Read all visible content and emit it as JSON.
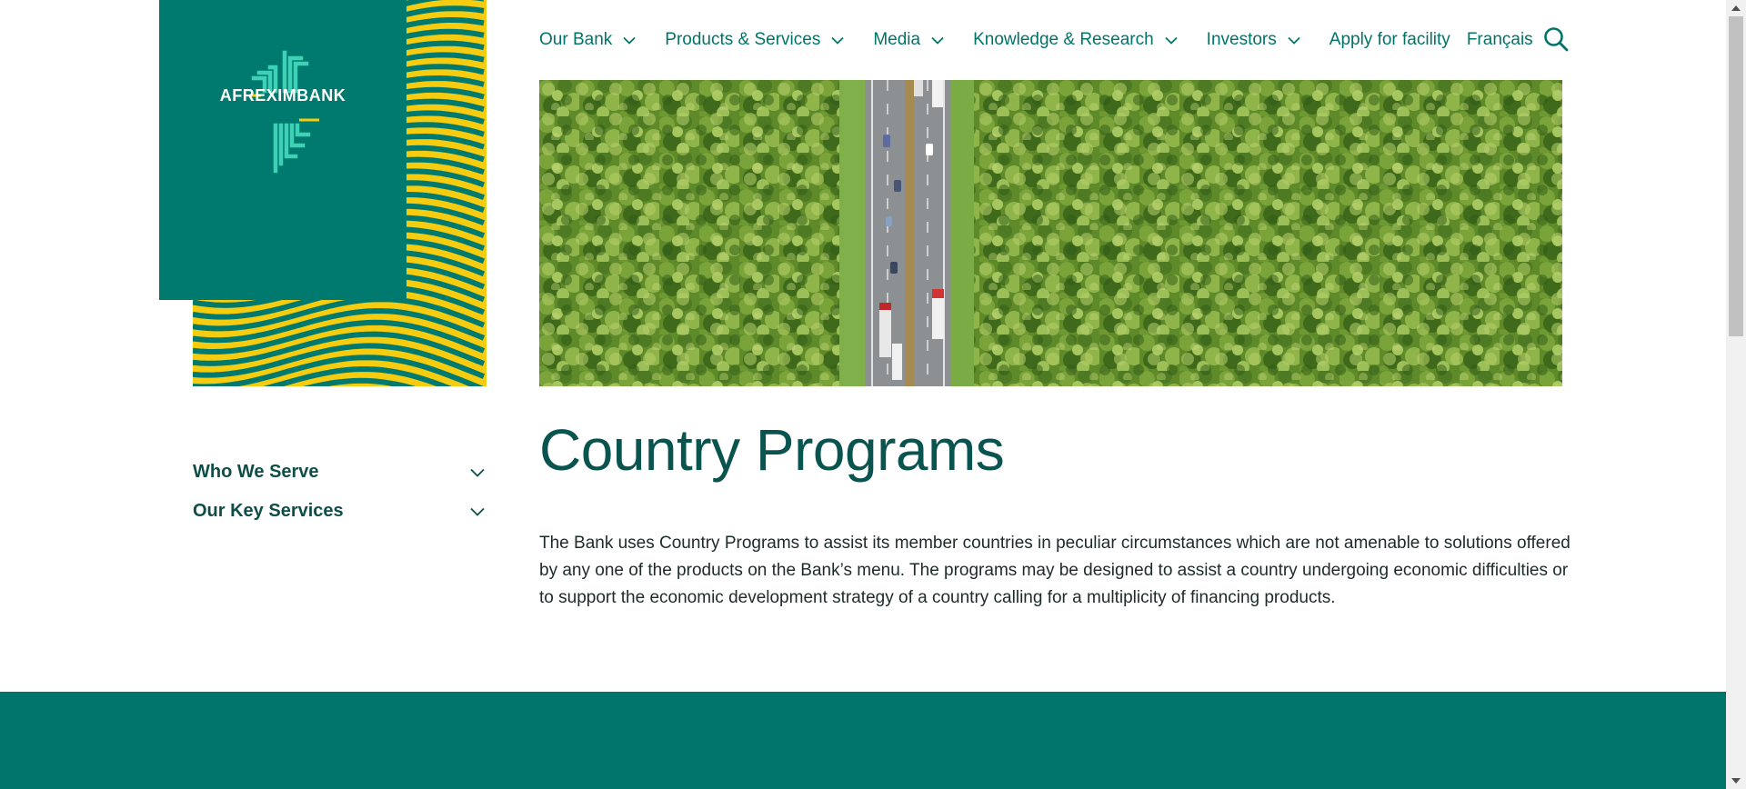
{
  "brand": {
    "name": "AFREXIMBANK",
    "colors": {
      "teal": "#007a6f",
      "yellow": "#f5cc0f",
      "light_teal": "#3fd1b6",
      "footer": "#00756b"
    }
  },
  "nav": {
    "items": [
      {
        "label": "Our Bank",
        "has_dropdown": true
      },
      {
        "label": "Products & Services",
        "has_dropdown": true
      },
      {
        "label": "Media",
        "has_dropdown": true
      },
      {
        "label": "Knowledge & Research",
        "has_dropdown": true
      },
      {
        "label": "Investors",
        "has_dropdown": true
      }
    ],
    "apply_label": "Apply for facility",
    "language_label": "Français",
    "search_icon": "search-icon"
  },
  "hero": {
    "image": "aerial-highway-through-forest"
  },
  "sidebar": {
    "items": [
      {
        "label": "Who We Serve",
        "icon": "chevron-down-icon"
      },
      {
        "label": "Our Key Services",
        "icon": "chevron-down-icon"
      }
    ]
  },
  "page": {
    "title": "Country Programs",
    "body": "The Bank uses Country Programs to assist its member countries in peculiar circumstances which are not amenable to solutions offered by any one of the products on the Bank’s menu. The programs may be designed to assist a country undergoing economic difficulties or to support the economic development strategy of a country calling for a multiplicity of financing products."
  }
}
